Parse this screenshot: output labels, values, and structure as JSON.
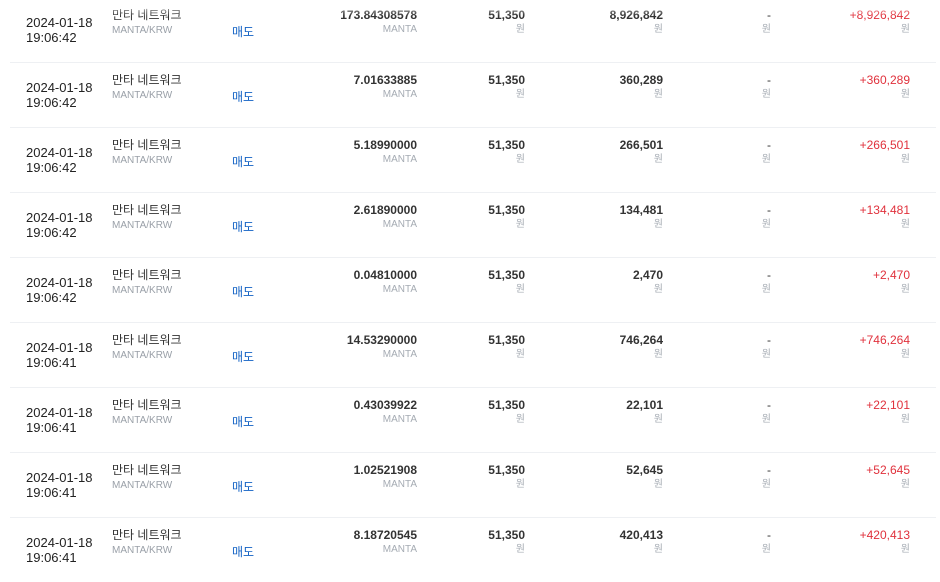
{
  "labels": {
    "coin_name": "만타 네트워크",
    "pair": "MANTA/KRW",
    "side": "매도",
    "qty_unit": "MANTA",
    "krw_unit": "원",
    "fee_value": "-"
  },
  "colors": {
    "sell": "#1261c4",
    "settlement": "#e0313c"
  },
  "rows": [
    {
      "date": "2024-01-18",
      "time": "19:06:42",
      "quantity": "173.84308578",
      "price": "51,350",
      "amount": "8,926,842",
      "settlement": "+8,926,842"
    },
    {
      "date": "2024-01-18",
      "time": "19:06:42",
      "quantity": "7.01633885",
      "price": "51,350",
      "amount": "360,289",
      "settlement": "+360,289"
    },
    {
      "date": "2024-01-18",
      "time": "19:06:42",
      "quantity": "5.18990000",
      "price": "51,350",
      "amount": "266,501",
      "settlement": "+266,501"
    },
    {
      "date": "2024-01-18",
      "time": "19:06:42",
      "quantity": "2.61890000",
      "price": "51,350",
      "amount": "134,481",
      "settlement": "+134,481"
    },
    {
      "date": "2024-01-18",
      "time": "19:06:42",
      "quantity": "0.04810000",
      "price": "51,350",
      "amount": "2,470",
      "settlement": "+2,470"
    },
    {
      "date": "2024-01-18",
      "time": "19:06:41",
      "quantity": "14.53290000",
      "price": "51,350",
      "amount": "746,264",
      "settlement": "+746,264"
    },
    {
      "date": "2024-01-18",
      "time": "19:06:41",
      "quantity": "0.43039922",
      "price": "51,350",
      "amount": "22,101",
      "settlement": "+22,101"
    },
    {
      "date": "2024-01-18",
      "time": "19:06:41",
      "quantity": "1.02521908",
      "price": "51,350",
      "amount": "52,645",
      "settlement": "+52,645"
    },
    {
      "date": "2024-01-18",
      "time": "19:06:41",
      "quantity": "8.18720545",
      "price": "51,350",
      "amount": "420,413",
      "settlement": "+420,413"
    }
  ]
}
